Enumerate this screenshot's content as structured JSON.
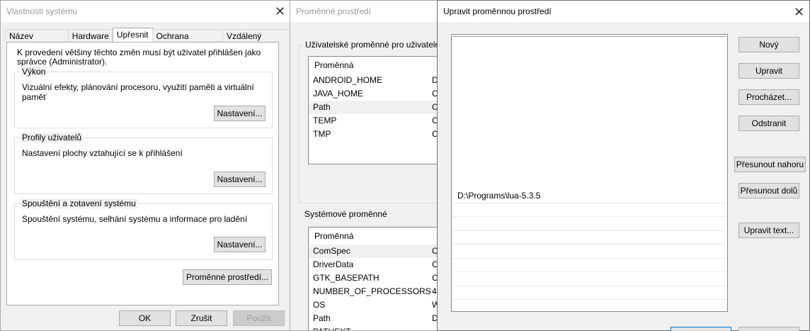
{
  "system_props": {
    "title": "Vlastnosti systému",
    "tabs": [
      "Název počítače",
      "Hardware",
      "Upřesnit",
      "Ochrana systému",
      "Vzdálený přístup"
    ],
    "admin_note": "K provedení většiny těchto změn musí být uživatel přihlášen jako správce (Administrator).",
    "groups": [
      {
        "title": "Výkon",
        "desc": "Vizuální efekty, plánování procesoru, využití paměti a virtuální paměť",
        "button": "Nastavení..."
      },
      {
        "title": "Profily uživatelů",
        "desc": "Nastavení plochy vztahující se k přihlášení",
        "button": "Nastavení..."
      },
      {
        "title": "Spouštění a zotavení systému",
        "desc": "Spouštění systému, selhání systému a informace pro ladění",
        "button": "Nastavení..."
      }
    ],
    "env_button": "Proměnné prostředí...",
    "ok": "OK",
    "cancel": "Zrušit",
    "apply": "Použít"
  },
  "env_vars": {
    "title": "Proměnné prostředí",
    "user_section": "Uživatelské proměnné pro uživatele",
    "system_section": "Systémové proměnné",
    "col_variable": "Proměnná",
    "col_value": "H",
    "user_rows": [
      {
        "name": "ANDROID_HOME",
        "value": "D"
      },
      {
        "name": "JAVA_HOME",
        "value": "C"
      },
      {
        "name": "Path",
        "value": "C"
      },
      {
        "name": "TEMP",
        "value": "C"
      },
      {
        "name": "TMP",
        "value": "C"
      }
    ],
    "system_rows": [
      {
        "name": "ComSpec",
        "value": "C"
      },
      {
        "name": "DriverData",
        "value": "C"
      },
      {
        "name": "GTK_BASEPATH",
        "value": "C"
      },
      {
        "name": "NUMBER_OF_PROCESSORS",
        "value": "4"
      },
      {
        "name": "OS",
        "value": "W"
      },
      {
        "name": "Path",
        "value": "D"
      },
      {
        "name": "PATHEXT",
        "value": "."
      }
    ]
  },
  "edit_env": {
    "title": "Upravit proměnnou prostředí",
    "path_entries": [
      "",
      "",
      "",
      "",
      "",
      "",
      "",
      "",
      "",
      "",
      "",
      "D:\\Programs\\lua-5.3.5",
      "",
      "",
      "",
      "",
      "",
      "",
      ""
    ],
    "buttons": {
      "new": "Nový",
      "edit": "Upravit",
      "browse": "Procházet...",
      "delete": "Odstranit",
      "move_up": "Přesunout nahoru",
      "move_down": "Přesunout dolů",
      "edit_text": "Upravit text..."
    }
  }
}
